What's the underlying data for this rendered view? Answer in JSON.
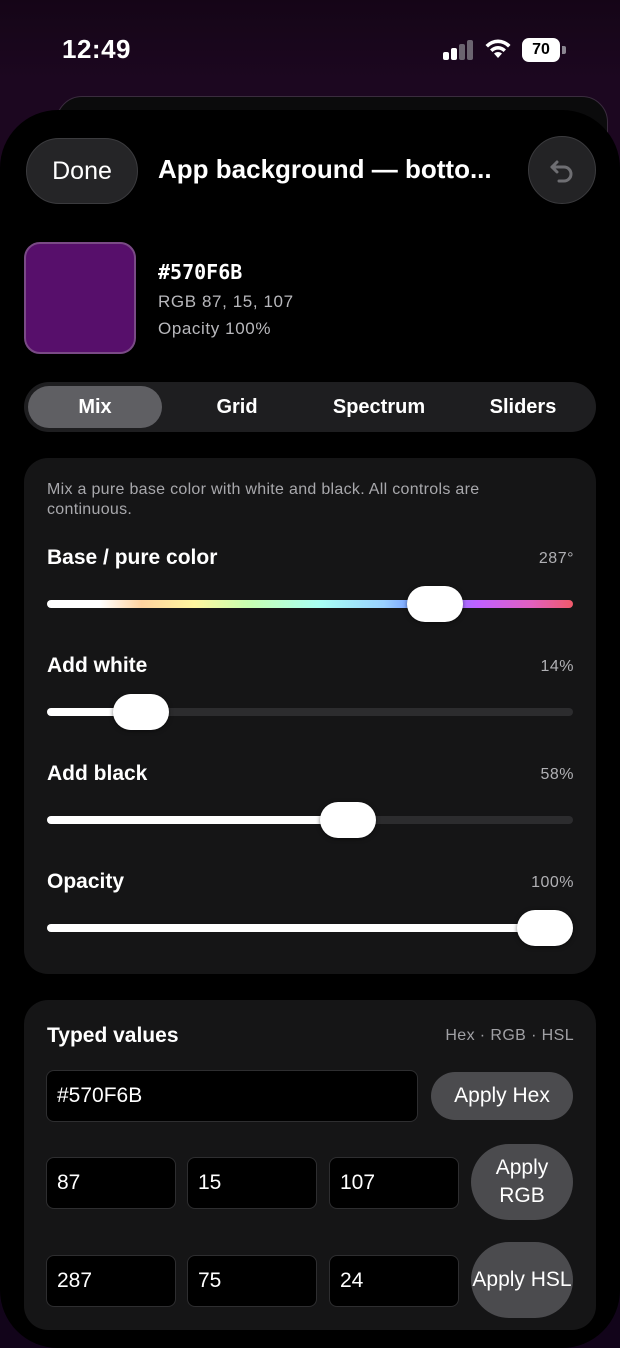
{
  "status": {
    "time": "12:49",
    "battery": "70"
  },
  "header": {
    "done_label": "Done",
    "title": "App background — botto..."
  },
  "color": {
    "swatch_hex": "#570F6B",
    "hex": "#570F6B",
    "rgb_text": "RGB 87, 15, 107",
    "opacity_text": "Opacity 100%"
  },
  "tabs": [
    {
      "label": "Mix",
      "active": true
    },
    {
      "label": "Grid",
      "active": false
    },
    {
      "label": "Spectrum",
      "active": false
    },
    {
      "label": "Sliders",
      "active": false
    }
  ],
  "mix": {
    "description": "Mix a pure base color with white and black. All controls are continuous.",
    "controls": [
      {
        "label": "Base / pure color",
        "value": "287°",
        "fraction": 0.767
      },
      {
        "label": "Add white",
        "value": "14%",
        "fraction": 0.14
      },
      {
        "label": "Add black",
        "value": "58%",
        "fraction": 0.58
      },
      {
        "label": "Opacity",
        "value": "100%",
        "fraction": 1.0
      }
    ]
  },
  "typed": {
    "title": "Typed values",
    "hint": "Hex · RGB · HSL",
    "hex_value": "#570F6B",
    "apply_hex": "Apply Hex",
    "rgb": [
      "87",
      "15",
      "107"
    ],
    "apply_rgb": "Apply RGB",
    "hsl": [
      "287",
      "75",
      "24"
    ],
    "apply_hsl": "Apply HSL"
  },
  "colors": {
    "accent_purple": "#570F6B",
    "sheet_bg": "#000000",
    "card_bg": "#151516",
    "active_tab": "#5f5f63"
  }
}
